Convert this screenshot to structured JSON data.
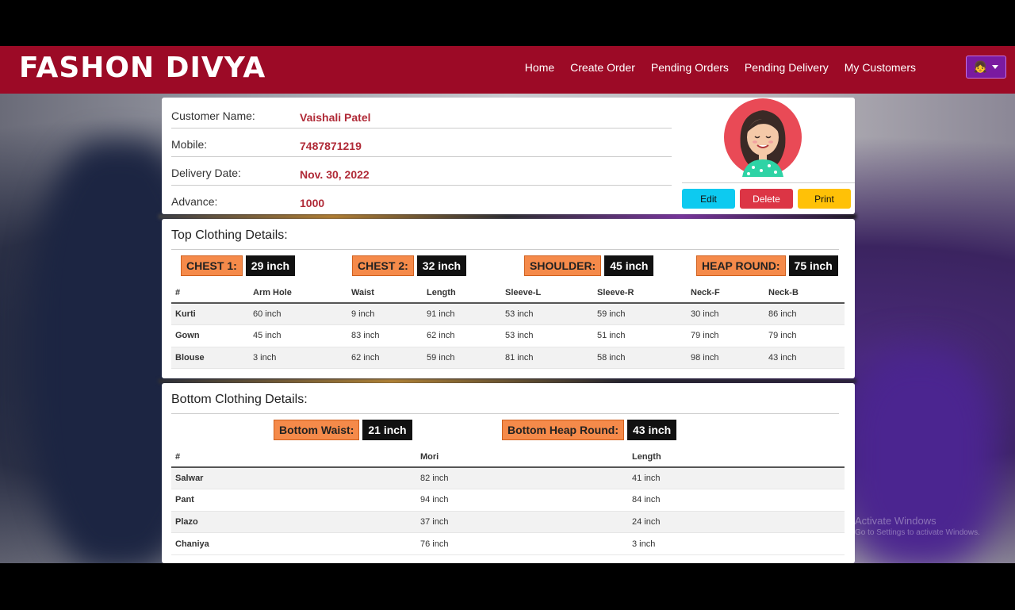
{
  "brand": "FASHON DIVYA",
  "nav": {
    "links": [
      "Home",
      "Create Order",
      "Pending Orders",
      "Pending Delivery",
      "My Customers"
    ],
    "user_icon": "girl-emoji"
  },
  "customer": {
    "name_label": "Customer Name:",
    "name": "Vaishali Patel",
    "mobile_label": "Mobile:",
    "mobile": "7487871219",
    "delivery_label": "Delivery Date:",
    "delivery": "Nov. 30, 2022",
    "advance_label": "Advance:",
    "advance": "1000"
  },
  "actions": {
    "edit": "Edit",
    "delete": "Delete",
    "print": "Print"
  },
  "top": {
    "title": "Top Clothing Details:",
    "tags": [
      {
        "k": "CHEST 1:",
        "v": "29 inch"
      },
      {
        "k": "CHEST 2:",
        "v": "32 inch"
      },
      {
        "k": "SHOULDER:",
        "v": "45 inch"
      },
      {
        "k": "HEAP ROUND:",
        "v": "75 inch"
      }
    ],
    "headers": [
      "#",
      "Arm Hole",
      "Waist",
      "Length",
      "Sleeve-L",
      "Sleeve-R",
      "Neck-F",
      "Neck-B"
    ],
    "rows": [
      [
        "Kurti",
        "60 inch",
        "9 inch",
        "91 inch",
        "53 inch",
        "59 inch",
        "30 inch",
        "86 inch"
      ],
      [
        "Gown",
        "45 inch",
        "83 inch",
        "62 inch",
        "53 inch",
        "51 inch",
        "79 inch",
        "79 inch"
      ],
      [
        "Blouse",
        "3 inch",
        "62 inch",
        "59 inch",
        "81 inch",
        "58 inch",
        "98 inch",
        "43 inch"
      ]
    ]
  },
  "bottom": {
    "title": "Bottom Clothing Details:",
    "tags": [
      {
        "k": "Bottom Waist:",
        "v": "21 inch"
      },
      {
        "k": "Bottom Heap Round:",
        "v": "43 inch"
      }
    ],
    "headers": [
      "#",
      "Mori",
      "Length"
    ],
    "rows": [
      [
        "Salwar",
        "82 inch",
        "41 inch"
      ],
      [
        "Pant",
        "94 inch",
        "84 inch"
      ],
      [
        "Plazo",
        "37 inch",
        "24 inch"
      ],
      [
        "Chaniya",
        "76 inch",
        "3 inch"
      ]
    ]
  },
  "watermark": {
    "line1": "Activate Windows",
    "line2": "Go to Settings to activate Windows."
  },
  "colors": {
    "navbar": "#9c0a26",
    "accent_text": "#b02a37",
    "tag": "#f58a4a",
    "edit": "#0dcaf0",
    "delete": "#dc3545",
    "print": "#ffc107"
  }
}
